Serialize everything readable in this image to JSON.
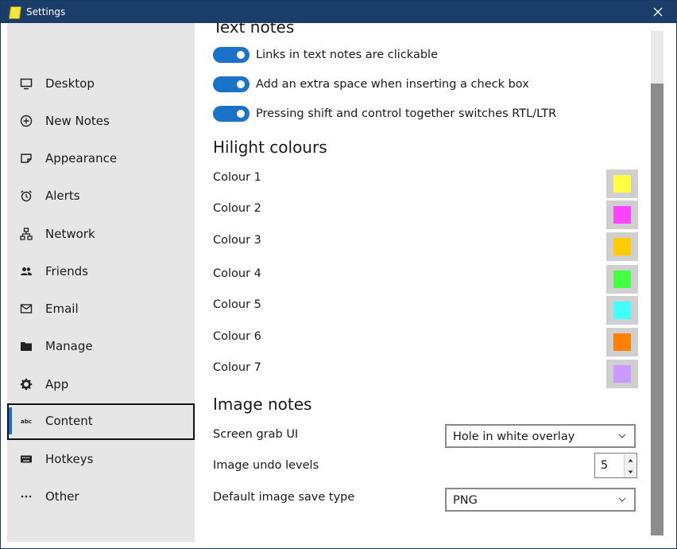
{
  "window": {
    "title": "Settings"
  },
  "sidebar": {
    "items": [
      {
        "label": "Desktop",
        "icon": "monitor-icon"
      },
      {
        "label": "New Notes",
        "icon": "plus-circle-icon"
      },
      {
        "label": "Appearance",
        "icon": "note-icon"
      },
      {
        "label": "Alerts",
        "icon": "alarm-clock-icon"
      },
      {
        "label": "Network",
        "icon": "network-icon"
      },
      {
        "label": "Friends",
        "icon": "people-icon"
      },
      {
        "label": "Email",
        "icon": "envelope-icon"
      },
      {
        "label": "Manage",
        "icon": "folder-icon"
      },
      {
        "label": "App",
        "icon": "gear-icon"
      },
      {
        "label": "Content",
        "icon": "abc-icon",
        "selected": true
      },
      {
        "label": "Hotkeys",
        "icon": "keyboard-icon"
      },
      {
        "label": "Other",
        "icon": "ellipsis-icon"
      }
    ]
  },
  "text_notes": {
    "title": "Text notes",
    "toggles": [
      {
        "label": "Links in text notes are clickable",
        "on": true
      },
      {
        "label": "Add an extra space when inserting a check box",
        "on": true
      },
      {
        "label": "Pressing shift and control together switches RTL/LTR",
        "on": true
      }
    ]
  },
  "hilight": {
    "title": "Hilight colours",
    "colours": [
      {
        "label": "Colour 1",
        "color": "#ffff44"
      },
      {
        "label": "Colour 2",
        "color": "#ff44ff"
      },
      {
        "label": "Colour 3",
        "color": "#ffcc00"
      },
      {
        "label": "Colour 4",
        "color": "#44ff44"
      },
      {
        "label": "Colour 5",
        "color": "#44ffff"
      },
      {
        "label": "Colour 6",
        "color": "#ff8000"
      },
      {
        "label": "Colour 7",
        "color": "#cc99ff"
      }
    ]
  },
  "image_notes": {
    "title": "Image notes",
    "screen_grab": {
      "label": "Screen grab UI",
      "value": "Hole in white overlay"
    },
    "undo_levels": {
      "label": "Image undo levels",
      "value": "5"
    },
    "save_type": {
      "label": "Default image save type",
      "value": "PNG"
    }
  },
  "colors": {
    "accent": "#1a73c8",
    "titlebar": "#1b3d6a",
    "sidebar_bg": "#e6e6e6"
  }
}
